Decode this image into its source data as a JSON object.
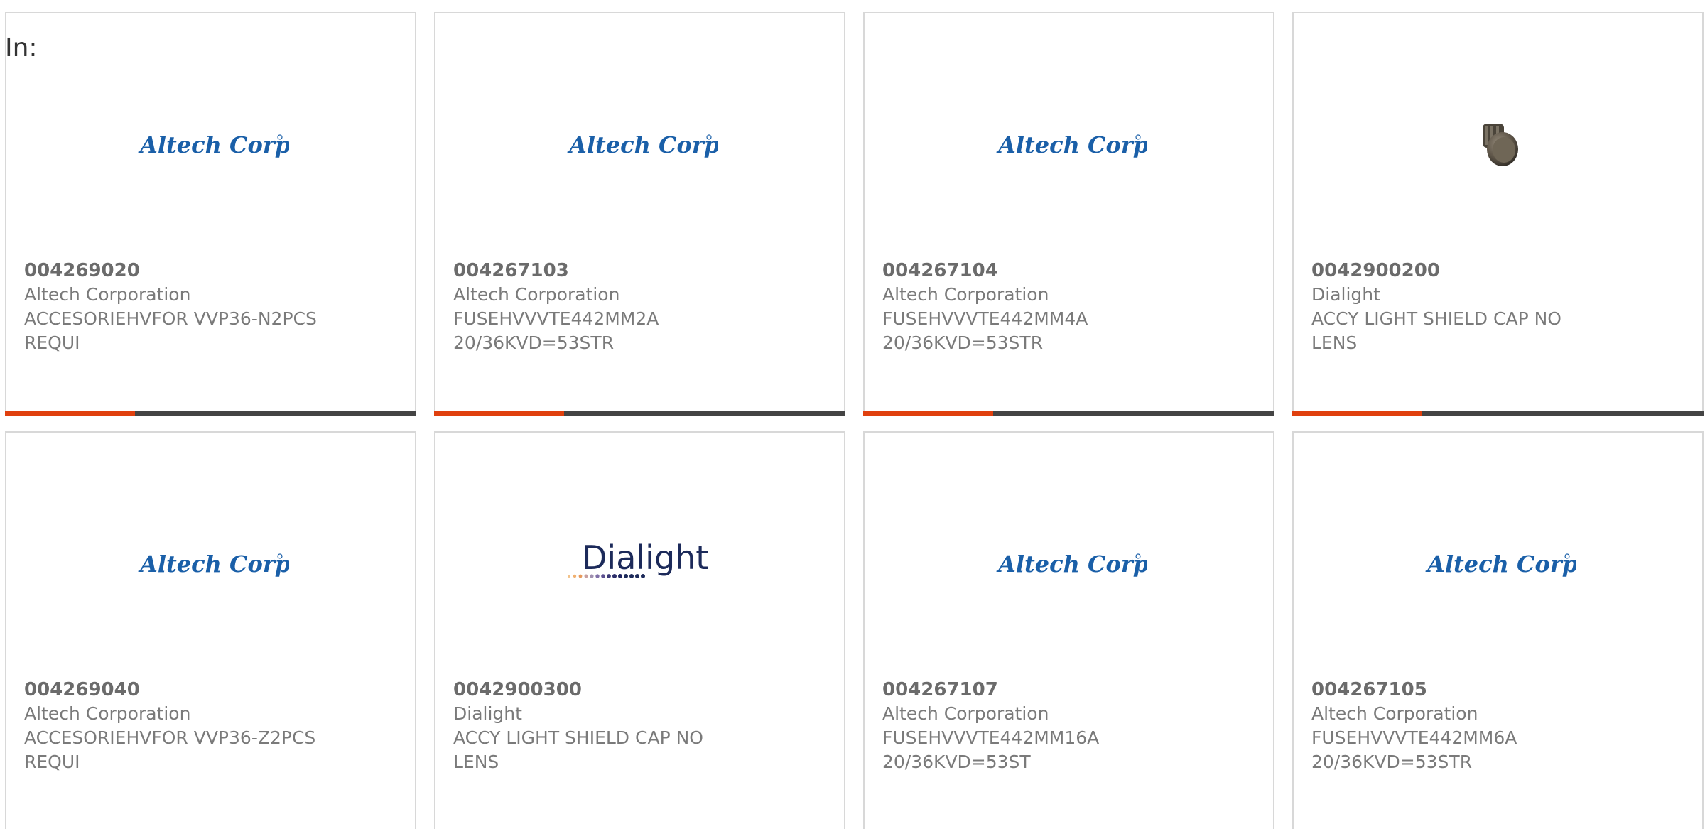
{
  "filter": {
    "label": "In:"
  },
  "colors": {
    "accent": "#e0400e",
    "bar": "#444444",
    "brand_altech": "#1a5fa8",
    "brand_dialight": "#1c2a5a"
  },
  "products": [
    {
      "part_no": "004269020",
      "manufacturer": "Altech Corporation",
      "description": "ACCESORIEHVFOR VVP36-N2PCS REQUI",
      "logo": "Altech Corp.",
      "logo_type": "altech"
    },
    {
      "part_no": "004267103",
      "manufacturer": "Altech Corporation",
      "description": "FUSEHVVVTE442MM2A 20/36KVD=53STR",
      "logo": "Altech Corp.",
      "logo_type": "altech"
    },
    {
      "part_no": "004267104",
      "manufacturer": "Altech Corporation",
      "description": "FUSEHVVVTE442MM4A 20/36KVD=53STR",
      "logo": "Altech Corp.",
      "logo_type": "altech"
    },
    {
      "part_no": "0042900200",
      "manufacturer": "Dialight",
      "description": "ACCY LIGHT SHIELD CAP NO LENS",
      "logo": "",
      "logo_type": "product-photo"
    },
    {
      "part_no": "004269040",
      "manufacturer": "Altech Corporation",
      "description": "ACCESORIEHVFOR VVP36-Z2PCS REQUI",
      "logo": "Altech Corp.",
      "logo_type": "altech"
    },
    {
      "part_no": "0042900300",
      "manufacturer": "Dialight",
      "description": "ACCY LIGHT SHIELD CAP NO LENS",
      "logo": "Dialight",
      "logo_type": "dialight"
    },
    {
      "part_no": "004267107",
      "manufacturer": "Altech Corporation",
      "description": "FUSEHVVVTE442MM16A 20/36KVD=53ST",
      "logo": "Altech Corp.",
      "logo_type": "altech"
    },
    {
      "part_no": "004267105",
      "manufacturer": "Altech Corporation",
      "description": "FUSEHVVVTE442MM6A 20/36KVD=53STR",
      "logo": "Altech Corp.",
      "logo_type": "altech"
    }
  ]
}
